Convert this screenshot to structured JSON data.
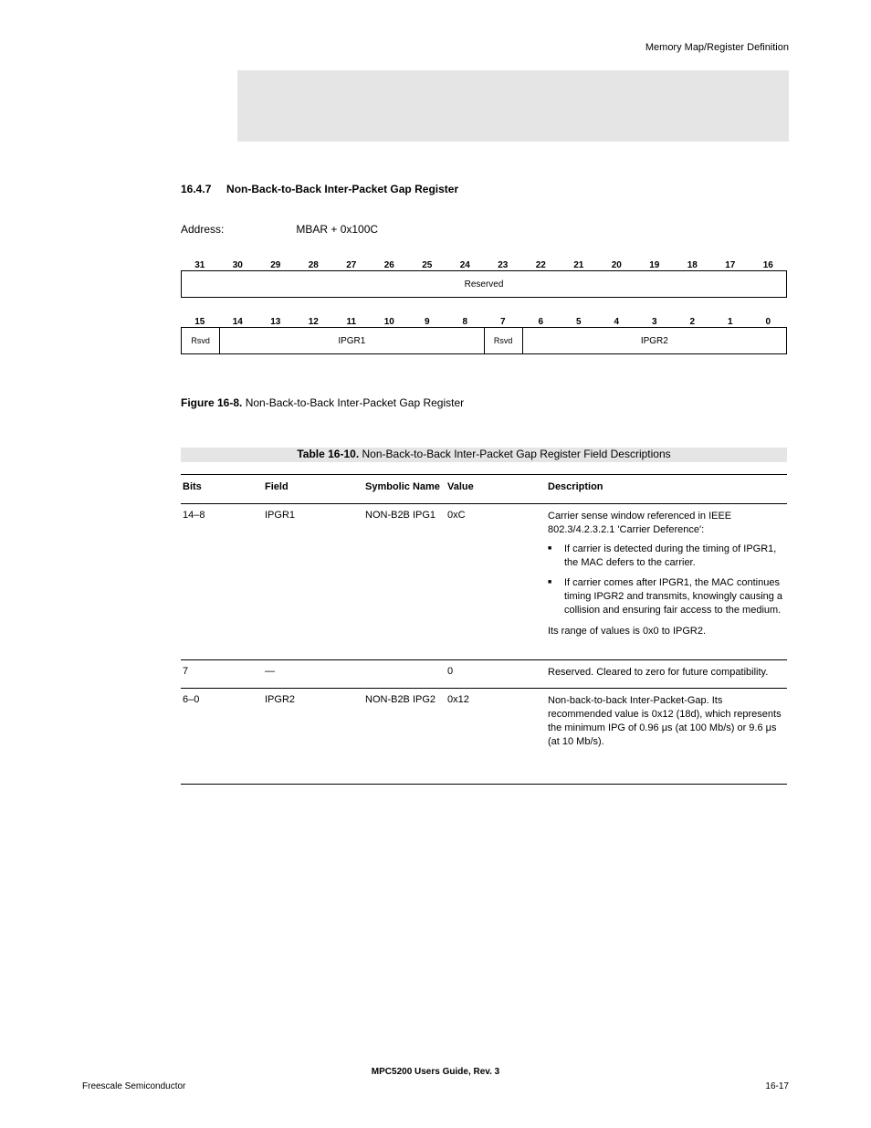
{
  "header_top_right": "Memory Map/Register Definition",
  "section": {
    "number": "16.4.7",
    "title": "Non-Back-to-Back Inter-Packet Gap Register"
  },
  "address_label": "Address:",
  "address_value": "MBAR + 0x100C",
  "figure": {
    "bitnums_high": [
      "31",
      "30",
      "29",
      "28",
      "27",
      "26",
      "25",
      "24",
      "23",
      "22",
      "21",
      "20",
      "19",
      "18",
      "17",
      "16"
    ],
    "row_high": [
      {
        "label": "Reserved",
        "cols": 16
      }
    ],
    "bitnums_low": [
      "15",
      "14",
      "13",
      "12",
      "11",
      "10",
      "9",
      "8",
      "7",
      "6",
      "5",
      "4",
      "3",
      "2",
      "1",
      "0"
    ],
    "row_low": [
      {
        "label": "Rsvd",
        "cols": 1
      },
      {
        "label": "IPGR1",
        "cols": 7
      },
      {
        "label": "Rsvd",
        "cols": 1
      },
      {
        "label": "IPGR2",
        "cols": 7
      }
    ],
    "caption_label": "Figure 16-8.",
    "caption_text": "Non-Back-to-Back Inter-Packet Gap Register"
  },
  "table_caption_label": "Table 16-10.",
  "table_caption_text": "Non-Back-to-Back Inter-Packet Gap Register Field Descriptions",
  "table_headers": [
    "Bits",
    "Field",
    "Symbolic Name",
    "Value",
    "Description"
  ],
  "rows": [
    {
      "bits": "14–8",
      "field": "IPGR1",
      "sym": "NON-B2B IPG1",
      "value": "0xC",
      "desc_intro": "Carrier sense window referenced in IEEE 802.3/4.2.3.2.1 'Carrier Deference':",
      "bullets": [
        "If carrier is detected during the timing of IPGR1, the MAC defers to the carrier.",
        "If carrier comes after IPGR1, the MAC continues timing IPGR2 and transmits, knowingly causing a collision and ensuring fair access to the medium."
      ],
      "desc_outro": "Its range of values is 0x0 to IPGR2."
    },
    {
      "bits": "7",
      "field": "—",
      "sym": "",
      "value": "0",
      "desc_intro": "Reserved. Cleared to zero for future compatibility.",
      "bullets": [],
      "desc_outro": ""
    },
    {
      "bits": "6–0",
      "field": "IPGR2",
      "sym": "NON-B2B IPG2",
      "value": "0x12",
      "desc_intro": "Non-back-to-back Inter-Packet-Gap. Its recommended value is 0x12 (18d), which represents the minimum IPG of 0.96 μs (at 100 Mb/s) or 9.6 μs (at 10 Mb/s).",
      "bullets": [],
      "desc_outro": ""
    }
  ],
  "footer_left": "MPC5200 Users Guide, Rev. 3",
  "footer_center": "Freescale Semiconductor",
  "footer_right": "16-17"
}
